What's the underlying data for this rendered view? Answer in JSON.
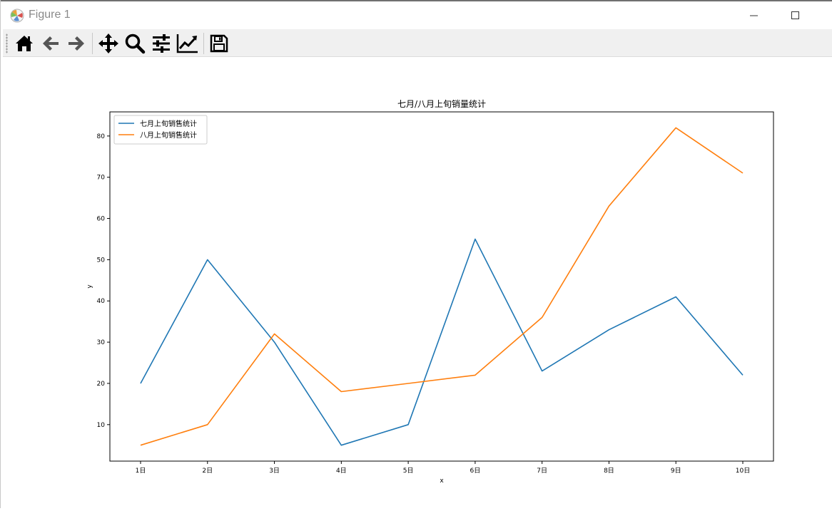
{
  "window": {
    "title": "Figure 1"
  },
  "toolbar": {
    "buttons": [
      "home-icon",
      "back-arrow-icon",
      "forward-arrow-icon",
      "pan-icon",
      "zoom-icon",
      "configure-subplots-icon",
      "edit-axis-icon",
      "save-icon"
    ]
  },
  "colors": {
    "series1": "#1f77b4",
    "series2": "#ff7f0e",
    "axes": "#000000"
  },
  "chart_data": {
    "type": "line",
    "title": "七月/八月上旬销量统计",
    "xlabel": "x",
    "ylabel": "y",
    "categories": [
      "1日",
      "2日",
      "3日",
      "4日",
      "5日",
      "6日",
      "7日",
      "8日",
      "9日",
      "10日"
    ],
    "yticks": [
      10,
      20,
      30,
      40,
      50,
      60,
      70,
      80
    ],
    "ylim": [
      1.15,
      85.85
    ],
    "grid": false,
    "legend_position": "top-left",
    "series": [
      {
        "name": "七月上旬销售统计",
        "color": "#1f77b4",
        "values": [
          20,
          50,
          30,
          5,
          10,
          55,
          23,
          33,
          41,
          22
        ]
      },
      {
        "name": "八月上旬销售统计",
        "color": "#ff7f0e",
        "values": [
          5,
          10,
          32,
          18,
          20,
          22,
          36,
          63,
          82,
          71
        ]
      }
    ]
  }
}
